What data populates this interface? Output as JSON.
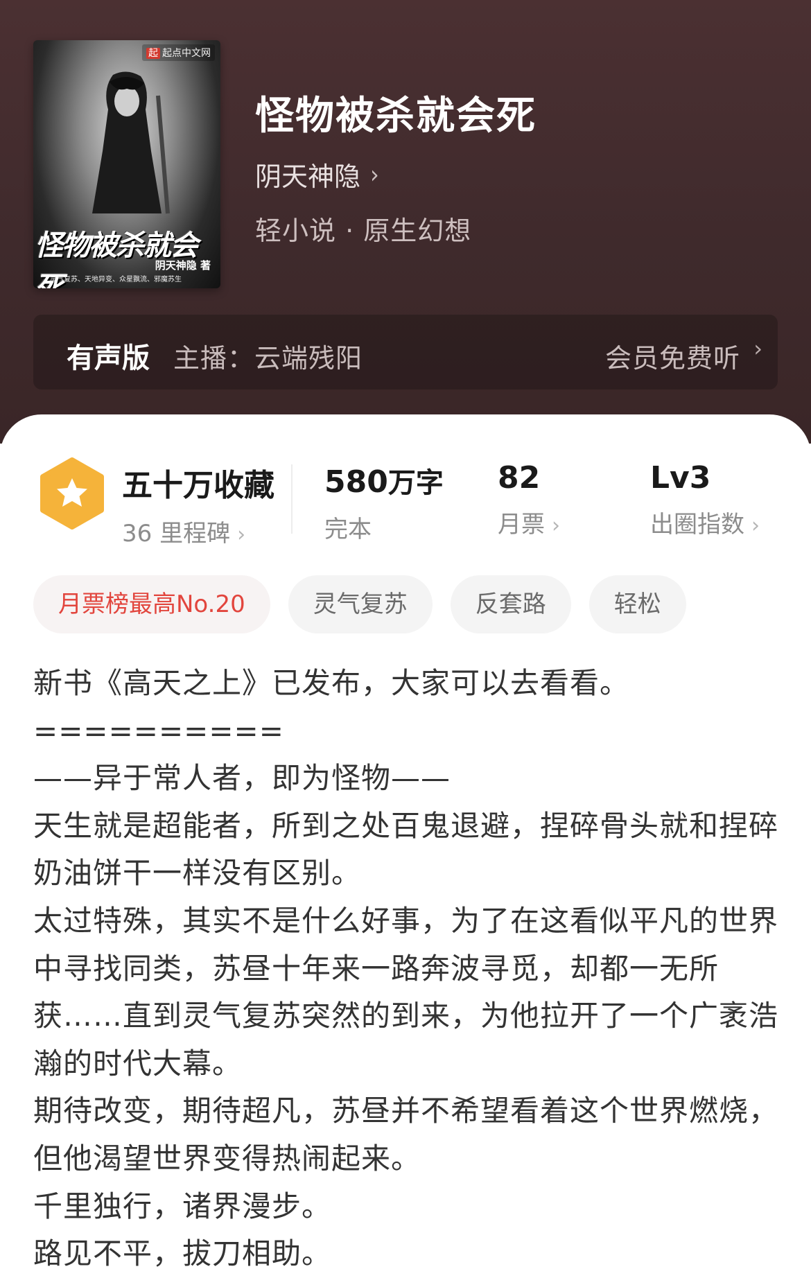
{
  "book": {
    "title": "怪物被杀就会死",
    "author": "阴天神隐",
    "genre": "轻小说 · 原生幻想",
    "cover": {
      "publisher_mark": "起",
      "publisher": "起点中文网",
      "title": "怪物被杀就会死",
      "author": "阴天神隐 著",
      "tags": "灵气复苏、天地异变、众星飘流、邪魔苏生"
    }
  },
  "audio": {
    "label": "有声版",
    "host": "主播：云端残阳",
    "action": "会员免费听"
  },
  "stats": {
    "favorites": "五十万收藏",
    "milestones": "36 里程碑",
    "words_value": "580",
    "words_unit": "万字",
    "status": "完本",
    "monthly_votes": "82",
    "monthly_votes_label": "月票",
    "level": "Lv3",
    "level_label": "出圈指数"
  },
  "tags": [
    "月票榜最高No.20",
    "灵气复苏",
    "反套路",
    "轻松"
  ],
  "description": [
    "新书《高天之上》已发布，大家可以去看看。",
    "==========",
    "——异于常人者，即为怪物——",
    "天生就是超能者，所到之处百鬼退避，捏碎骨头就和捏碎奶油饼干一样没有区别。",
    "太过特殊，其实不是什么好事，为了在这看似平凡的世界中寻找同类，苏昼十年来一路奔波寻觅，却都一无所获……直到灵气复苏突然的到来，为他拉开了一个广袤浩瀚的时代大幕。",
    "期待改变，期待超凡，苏昼并不希望看着这个世界燃烧，但他渴望世界变得热闹起来。",
    "千里独行，诸界漫步。",
    "路见不平，拔刀相助。"
  ],
  "colors": {
    "hero_bg": "#4b3032",
    "accent_tag": "#e2453d",
    "badge": "#f5b33a"
  },
  "icons": {
    "badge": "star-hexagon-icon",
    "chevron": "chevron-right-icon"
  }
}
